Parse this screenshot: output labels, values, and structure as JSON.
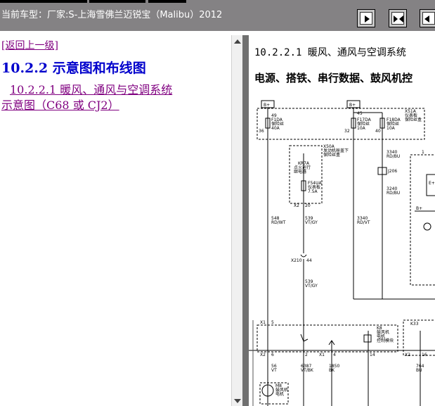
{
  "window": {
    "title": "当前车型：厂家:S-上海雪佛兰迈锐宝（Malibu）2012"
  },
  "toolbar": {
    "buttons": [
      {
        "name": "next-page-icon"
      },
      {
        "name": "expand-icon"
      },
      {
        "name": "previous-page-icon"
      }
    ]
  },
  "nav": {
    "back_link": "[返回上一级]",
    "section_title": "10.2.2 示意图和布线图",
    "sub_link_line1": "10.2.2.1 暖风、通风与空调系统",
    "sub_link_line2": "示意图（C68 或 CJ2）"
  },
  "content": {
    "heading": "10.2.2.1 暖风、通风与空调系统",
    "subheading": "电源、搭铁、串行数据、鼓风机控"
  },
  "diagram": {
    "labels": {
      "b1": "B+",
      "b2": "B+",
      "b3": "B+",
      "pin49": "49",
      "pin45": "45",
      "pin36": "36",
      "pin32": "32",
      "pin40": "40",
      "pin1": "1",
      "pin5": "5",
      "pin6": "6",
      "pin2": "2",
      "pin4": "4",
      "pin14": "14",
      "pin8": "8",
      "pin16": "16",
      "pin20": "20",
      "pin44": "44",
      "f1": "F1DA",
      "f1_desc": "保险丝",
      "f1_amp": "40A",
      "f17": "F17DA",
      "f17_desc": "保险丝",
      "f17_amp": "10A",
      "f18": "F18DA",
      "f18_desc": "保险丝",
      "f18_amp": "10A",
      "x51a": "X51A",
      "x51a_desc1": "仪表板",
      "x51a_desc2": "保险丝盒",
      "x50a": "X50A",
      "x50a_desc1": "发动机舱盖下",
      "x50a_desc2": "保险丝盒",
      "kr": "KR7A",
      "kr_desc1": "点火运行",
      "kr_desc2": "继电器",
      "f54": "F54UA",
      "f54_desc1": "仪表板",
      "f54_desc2": "7.5A",
      "x2a": "X2",
      "x2b": "X2",
      "x1a": "X1",
      "x1b": "X1",
      "x2c": "X2",
      "x2d": "X2",
      "x1c": "X1",
      "x210": "X210",
      "k8": "K8",
      "k8_desc1": "鼓风机",
      "k8_desc2": "电机",
      "k8_desc3": "控制模块",
      "k33": "K33",
      "m8": "M8",
      "m8_desc1": "鼓风机",
      "m8_desc2": "电机",
      "w548": "548",
      "w548c": "RD/WT",
      "w5391": "539",
      "w5391c": "VT/GY",
      "w5392": "539",
      "w5392c": "VT/GY",
      "w3240a": "3240",
      "w3240ac": "RD/BU",
      "w3240b": "3240",
      "w3240bc": "RD/BU",
      "w3340": "3340",
      "w3340c": "RD/VT",
      "w3340t": "3340",
      "w3340tc": "RD/BU",
      "wj206": "J206",
      "w56": "56",
      "w56c": "VT",
      "w6387": "6387",
      "w6387c": "VT/BK",
      "w1850": "1850",
      "w1850c": "BK",
      "w764": "764",
      "w764c": "BU",
      "eplus": "E+",
      "bplus": "B+"
    }
  }
}
